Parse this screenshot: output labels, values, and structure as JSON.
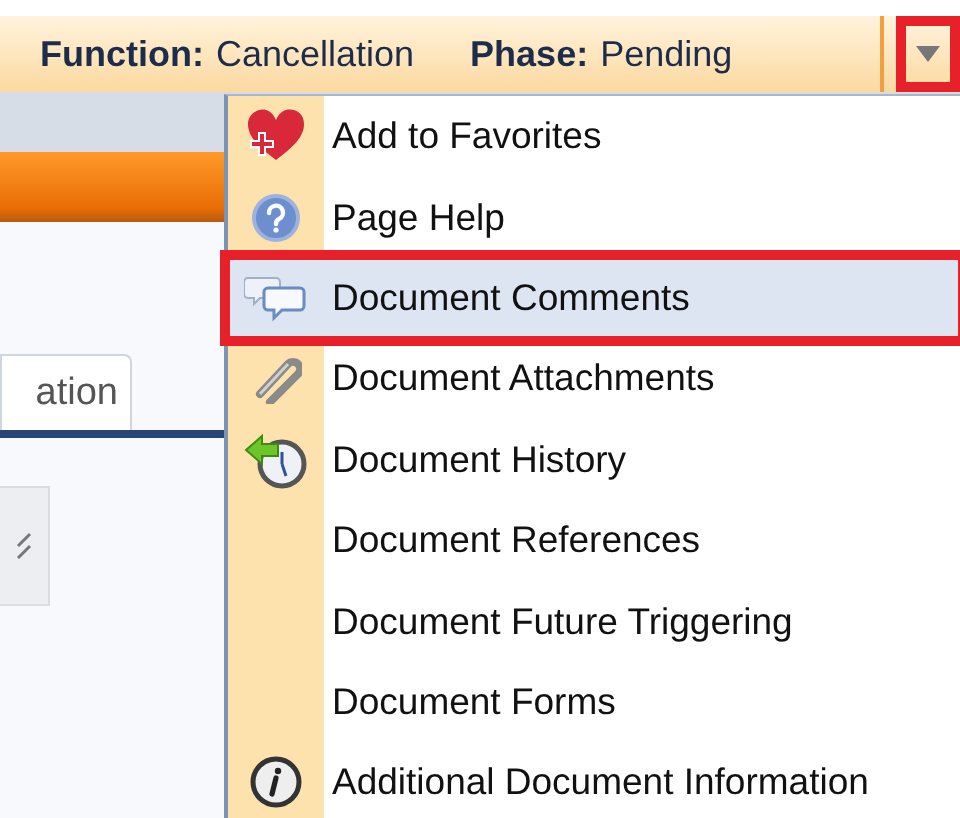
{
  "header": {
    "function_label": "Function:",
    "function_value": "Cancellation",
    "phase_label": "Phase:",
    "phase_value": "Pending",
    "menu_button": {
      "highlighted": true
    }
  },
  "tab": {
    "label": "ation"
  },
  "menu": [
    {
      "label": "Add to Favorites",
      "selected": false,
      "highlighted": false
    },
    {
      "label": "Page Help",
      "selected": false,
      "highlighted": false
    },
    {
      "label": "Document Comments",
      "selected": true,
      "highlighted": true
    },
    {
      "label": "Document Attachments",
      "selected": false,
      "highlighted": false
    },
    {
      "label": "Document History",
      "selected": false,
      "highlighted": false
    },
    {
      "label": "Document References",
      "selected": false,
      "highlighted": false
    },
    {
      "label": "Document Future Triggering",
      "selected": false,
      "highlighted": false
    },
    {
      "label": "Document Forms",
      "selected": false,
      "highlighted": false
    },
    {
      "label": "Additional Document Information",
      "selected": false,
      "highlighted": false
    }
  ]
}
